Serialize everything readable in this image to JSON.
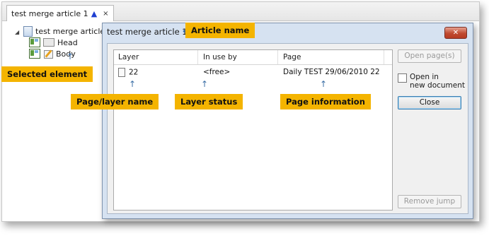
{
  "tab": {
    "title": "test merge article 1",
    "marker": "▲",
    "close": "×"
  },
  "tree": {
    "root_label": "test merge article 1",
    "children": [
      {
        "label": "Head"
      },
      {
        "label": "Body"
      }
    ]
  },
  "dialog": {
    "title": "test merge article 1",
    "close_glyph": "✕",
    "columns": [
      "Layer",
      "In use by",
      "Page"
    ],
    "rows": [
      {
        "layer": "22",
        "in_use_by": "<free>",
        "page": "Daily TEST 29/06/2010 22"
      }
    ],
    "buttons": {
      "open_pages": "Open page(s)",
      "open_in_line1": "Open in",
      "open_in_line2": "new document",
      "close": "Close",
      "remove_jump": "Remove jump"
    }
  },
  "callouts": {
    "article_name": "Article name",
    "selected_element": "Selected element",
    "page_layer_name": "Page/layer name",
    "layer_status": "Layer status",
    "page_information": "Page information"
  },
  "colors": {
    "callout": "#f4b400",
    "arrow": "#3a6ea5",
    "dialog_bg": "#d6e2f1",
    "close_button": "#c04a30",
    "tab_marker": "#1f3fd1"
  }
}
